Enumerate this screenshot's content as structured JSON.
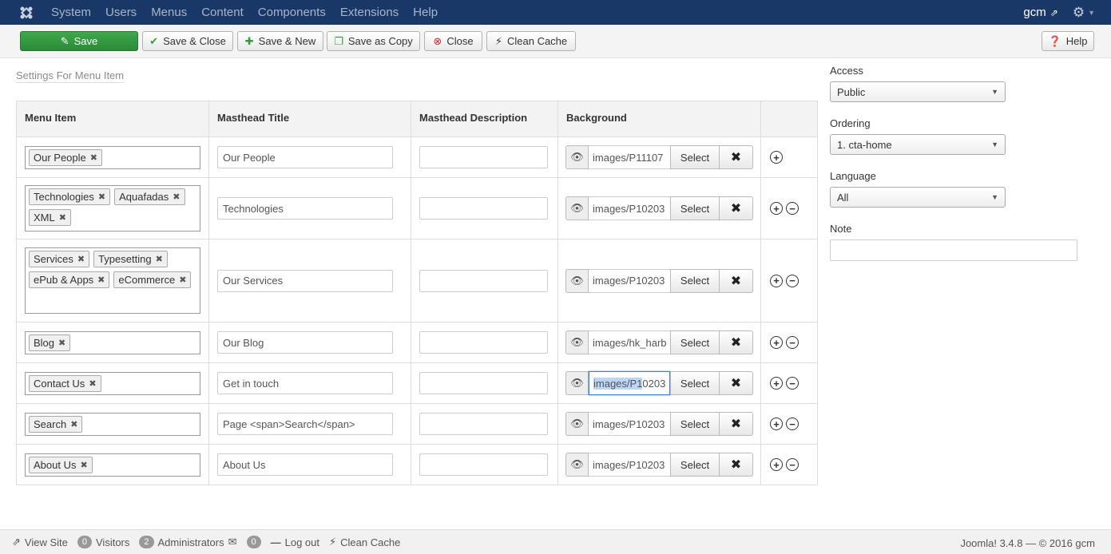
{
  "topbar": {
    "menu": [
      "System",
      "Users",
      "Menus",
      "Content",
      "Components",
      "Extensions",
      "Help"
    ],
    "user": "gcm"
  },
  "toolbar": {
    "save": "Save",
    "save_close": "Save & Close",
    "save_new": "Save & New",
    "save_copy": "Save as Copy",
    "close": "Close",
    "clean_cache": "Clean Cache",
    "help": "Help"
  },
  "form": {
    "legend": "Settings For Menu Item",
    "columns": [
      "Menu Item",
      "Masthead Title",
      "Masthead Description",
      "Background"
    ],
    "select_label": "Select",
    "rows": [
      {
        "tags": [
          "Our People"
        ],
        "title": "Our People",
        "description": "",
        "background": "images/P11107",
        "has_remove": false
      },
      {
        "tags": [
          "Technologies",
          "Aquafadas",
          "XML"
        ],
        "title": "Technologies",
        "description": "",
        "background": "images/P10203",
        "has_remove": true
      },
      {
        "tags": [
          "Services",
          "Typesetting",
          "ePub & Apps",
          "eCommerce"
        ],
        "title": "Our Services",
        "description": "",
        "background": "images/P10203",
        "has_remove": true
      },
      {
        "tags": [
          "Blog"
        ],
        "title": "Our Blog",
        "description": "",
        "background": "images/hk_harb",
        "has_remove": true
      },
      {
        "tags": [
          "Contact Us"
        ],
        "title": "Get in touch",
        "description": "",
        "background": "images/P10203",
        "background_selected": "images/P1",
        "background_rest": "0203",
        "has_remove": true
      },
      {
        "tags": [
          "Search"
        ],
        "title": "Page <span>Search</span>",
        "description": "",
        "background": "images/P10203",
        "has_remove": true
      },
      {
        "tags": [
          "About Us"
        ],
        "title": "About Us",
        "description": "",
        "background": "images/P10203",
        "has_remove": true
      }
    ]
  },
  "sidebar": {
    "access_label": "Access",
    "access_value": "Public",
    "ordering_label": "Ordering",
    "ordering_value": "1. cta-home",
    "language_label": "Language",
    "language_value": "All",
    "note_label": "Note",
    "note_value": ""
  },
  "footer": {
    "view_site": "View Site",
    "visitors_count": "0",
    "visitors_label": "Visitors",
    "admins_count": "2",
    "admins_label": "Administrators",
    "messages_count": "0",
    "logout": "Log out",
    "clean_cache": "Clean Cache",
    "version": "Joomla! 3.4.8 — © 2016 gcm"
  }
}
